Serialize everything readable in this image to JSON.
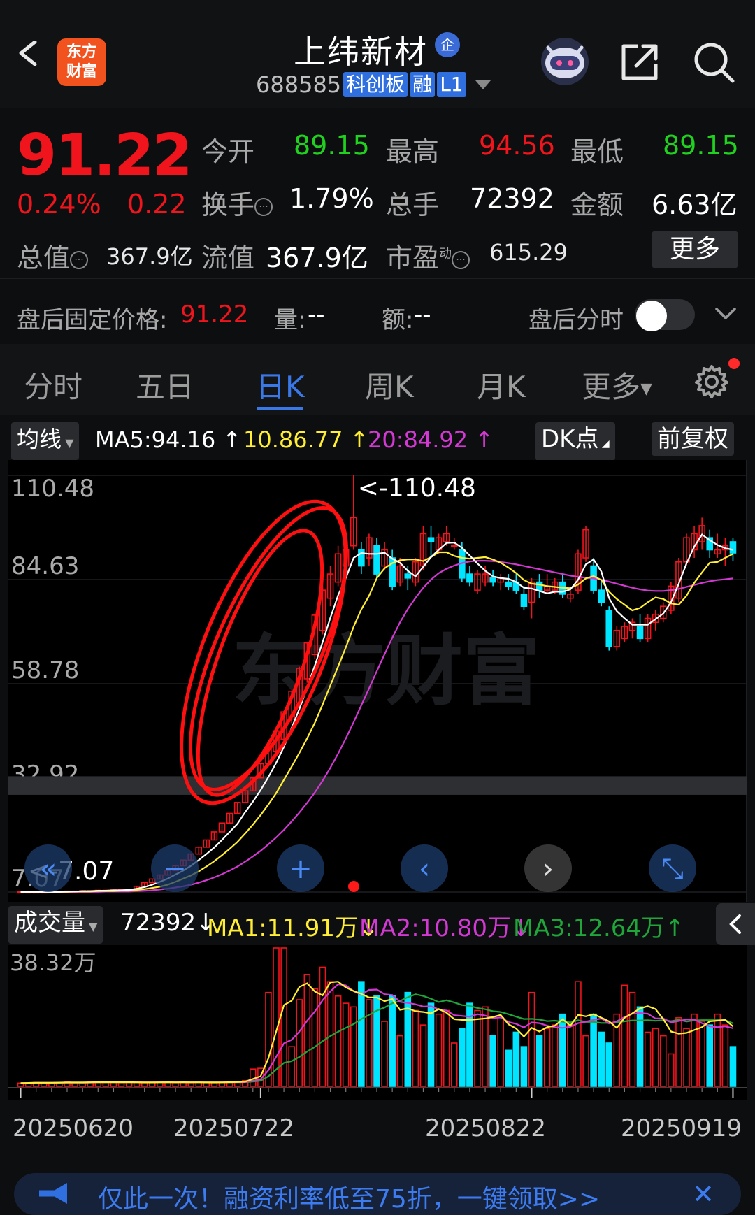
{
  "header": {
    "logo_text_1": "东方",
    "logo_text_2": "财富",
    "stock_name": "上纬新材",
    "badge": "企",
    "code": "688585",
    "tags": [
      "科创板",
      "融",
      "L1"
    ]
  },
  "quote": {
    "price": "91.22",
    "change_pct": "0.24%",
    "change": "0.22",
    "labels": {
      "open": "今开",
      "high": "最高",
      "low": "最低",
      "turnover": "换手",
      "volume": "总手",
      "amount": "金额",
      "total_value": "总值",
      "float_value": "流值",
      "pe": "市盈",
      "pe_sup": "动"
    },
    "values": {
      "open": "89.15",
      "high": "94.56",
      "low": "89.15",
      "turnover": "1.79%",
      "volume": "72392",
      "amount": "6.63亿",
      "total_value": "367.9亿",
      "float_value": "367.9亿",
      "pe": "615.29"
    },
    "more": "更多"
  },
  "after_hours": {
    "label": "盘后固定价格:",
    "price": "91.22",
    "vol_label": "量:",
    "vol_value": "--",
    "amt_label": "额:",
    "amt_value": "--",
    "intraday_label": "盘后分时"
  },
  "tabs": [
    "分时",
    "五日",
    "日K",
    "周K",
    "月K",
    "更多"
  ],
  "active_tab": "日K",
  "ma_bar": {
    "selector": "均线",
    "ma5": "MA5:94.16",
    "ma10": "10.86.77",
    "ma20": "20:84.92",
    "dk": "DK点",
    "fq": "前复权"
  },
  "colors": {
    "up": "#f0141c",
    "down": "#00e5ff",
    "ma5": "#ffffff",
    "ma10": "#ffee33",
    "ma20": "#d238d2",
    "ma3_vol": "#1fa53a",
    "accent": "#3b78e7"
  },
  "chart_data": {
    "type": "candlestick",
    "y_ticks": [
      "110.48",
      "84.63",
      "58.78",
      "32.92",
      "7.07"
    ],
    "ylim": [
      7.07,
      110.48
    ],
    "max_label": "<-110.48",
    "min_label": "<-7.07",
    "candles": [
      [
        7.1,
        7.2,
        7.0,
        7.1
      ],
      [
        7.1,
        7.1,
        7.0,
        7.1
      ],
      [
        7.1,
        7.2,
        7.0,
        7.1
      ],
      [
        7.1,
        7.2,
        7.0,
        7.1
      ],
      [
        7.1,
        7.2,
        7.0,
        7.2
      ],
      [
        7.2,
        7.3,
        7.1,
        7.2
      ],
      [
        7.2,
        7.3,
        7.1,
        7.3
      ],
      [
        7.3,
        7.4,
        7.2,
        7.3
      ],
      [
        7.3,
        7.4,
        7.2,
        7.4
      ],
      [
        7.4,
        7.5,
        7.3,
        7.4
      ],
      [
        7.4,
        7.5,
        7.3,
        7.5
      ],
      [
        7.5,
        7.6,
        7.4,
        7.5
      ],
      [
        7.5,
        7.6,
        7.4,
        7.6
      ],
      [
        7.6,
        7.7,
        7.5,
        7.7
      ],
      [
        7.7,
        7.8,
        7.6,
        7.8
      ],
      [
        7.8,
        8.5,
        7.8,
        8.5
      ],
      [
        8.5,
        9.5,
        8.5,
        9.4
      ],
      [
        9.4,
        10.4,
        9.4,
        10.3
      ],
      [
        10.3,
        11.4,
        10.3,
        11.3
      ],
      [
        11.3,
        12.5,
        11.3,
        12.4
      ],
      [
        12.4,
        13.7,
        12.4,
        13.6
      ],
      [
        13.6,
        15.0,
        13.6,
        15.0
      ],
      [
        15.0,
        16.5,
        15.0,
        16.5
      ],
      [
        16.5,
        18.2,
        16.5,
        18.2
      ],
      [
        18.2,
        20.0,
        18.2,
        20.0
      ],
      [
        20.0,
        22.0,
        20.0,
        22.0
      ],
      [
        22.0,
        24.2,
        22.0,
        24.2
      ],
      [
        24.2,
        26.6,
        24.2,
        26.6
      ],
      [
        26.6,
        29.3,
        26.6,
        29.3
      ],
      [
        29.3,
        32.2,
        29.3,
        32.2
      ],
      [
        32.2,
        35.4,
        32.2,
        35.4
      ],
      [
        35.4,
        38.9,
        35.4,
        38.9
      ],
      [
        38.9,
        42.8,
        38.9,
        42.8
      ],
      [
        42.0,
        47.1,
        41.0,
        47.1
      ],
      [
        45.0,
        52.0,
        44.0,
        51.8
      ],
      [
        50.0,
        57.0,
        49.0,
        56.9
      ],
      [
        54.0,
        63.0,
        53.0,
        62.6
      ],
      [
        60.0,
        69.0,
        59.0,
        68.9
      ],
      [
        66.0,
        76.0,
        65.0,
        75.8
      ],
      [
        72.0,
        83.0,
        71.0,
        82.0
      ],
      [
        80.0,
        88.0,
        78.0,
        86.0
      ],
      [
        84.0,
        93.0,
        83.0,
        91.0
      ],
      [
        88.0,
        94.0,
        85.0,
        92.0
      ],
      [
        93.0,
        110.48,
        92.0,
        100.0
      ],
      [
        92.0,
        94.0,
        86.0,
        88.0
      ],
      [
        90.0,
        96.0,
        88.0,
        95.0
      ],
      [
        93.0,
        95.0,
        85.0,
        86.0
      ],
      [
        88.0,
        94.0,
        87.0,
        92.0
      ],
      [
        90.0,
        92.0,
        82.0,
        83.0
      ],
      [
        84.0,
        90.0,
        83.0,
        88.0
      ],
      [
        86.0,
        88.0,
        82.0,
        85.0
      ],
      [
        84.0,
        90.0,
        83.0,
        89.0
      ],
      [
        88.0,
        98.0,
        87.0,
        96.0
      ],
      [
        95.0,
        98.0,
        90.0,
        94.0
      ],
      [
        92.0,
        96.0,
        91.0,
        95.0
      ],
      [
        94.0,
        98.0,
        93.0,
        96.0
      ],
      [
        93.0,
        95.0,
        92.0,
        93.0
      ],
      [
        92.0,
        94.0,
        84.0,
        85.0
      ],
      [
        86.0,
        88.0,
        83.0,
        84.0
      ],
      [
        82.0,
        87.0,
        81.0,
        86.0
      ],
      [
        84.0,
        88.0,
        83.0,
        86.0
      ],
      [
        85.0,
        87.0,
        83.0,
        84.0
      ],
      [
        84.0,
        86.0,
        82.0,
        85.0
      ],
      [
        84.0,
        86.0,
        82.0,
        83.0
      ],
      [
        84.0,
        86.0,
        81.0,
        82.0
      ],
      [
        81.0,
        83.0,
        77.0,
        78.0
      ],
      [
        79.0,
        85.0,
        75.0,
        84.0
      ],
      [
        84.0,
        86.0,
        80.0,
        82.0
      ],
      [
        82.0,
        86.0,
        81.0,
        83.0
      ],
      [
        82.0,
        85.0,
        81.0,
        84.0
      ],
      [
        84.0,
        86.0,
        80.0,
        81.0
      ],
      [
        80.0,
        82.0,
        79.0,
        81.0
      ],
      [
        82.0,
        92.0,
        81.0,
        91.0
      ],
      [
        90.0,
        98.0,
        89.0,
        97.0
      ],
      [
        88.0,
        90.0,
        81.0,
        82.0
      ],
      [
        82.0,
        84.0,
        78.0,
        79.0
      ],
      [
        77.0,
        78.0,
        67.0,
        68.0
      ],
      [
        68.0,
        73.0,
        67.0,
        72.0
      ],
      [
        70.0,
        74.0,
        69.0,
        73.0
      ],
      [
        72.0,
        75.0,
        70.0,
        74.0
      ],
      [
        73.0,
        76.0,
        69.0,
        70.0
      ],
      [
        70.0,
        76.0,
        69.0,
        75.0
      ],
      [
        74.0,
        77.0,
        72.0,
        76.0
      ],
      [
        75.0,
        79.0,
        74.0,
        78.0
      ],
      [
        77.0,
        84.0,
        76.0,
        83.0
      ],
      [
        80.0,
        90.0,
        79.0,
        89.0
      ],
      [
        89.0,
        96.0,
        88.0,
        95.0
      ],
      [
        92.0,
        98.0,
        90.0,
        96.0
      ],
      [
        94.0,
        100.0,
        92.0,
        98.0
      ],
      [
        95.0,
        97.0,
        90.0,
        92.0
      ],
      [
        91.0,
        96.0,
        90.0,
        92.0
      ],
      [
        92.0,
        95.0,
        88.0,
        93.0
      ],
      [
        94.0,
        95.0,
        89.15,
        91.22
      ]
    ],
    "ma5": [
      7.1,
      7.1,
      7.1,
      7.1,
      7.1,
      7.1,
      7.2,
      7.2,
      7.3,
      7.3,
      7.4,
      7.4,
      7.5,
      7.5,
      7.6,
      7.9,
      8.3,
      8.9,
      9.6,
      10.4,
      11.4,
      12.4,
      13.6,
      15.0,
      16.5,
      18.1,
      20.0,
      22.0,
      24.0,
      26.9,
      29.5,
      32.4,
      35.6,
      39.1,
      43.1,
      47.8,
      52.5,
      57.8,
      63.3,
      69.1,
      75.1,
      80.7,
      85.0,
      90.0,
      91.2,
      91.0,
      91.0,
      91.3,
      89.8,
      88.8,
      86.8,
      85.4,
      87.8,
      90.2,
      92.0,
      93.7,
      93.8,
      92.5,
      90.6,
      88.6,
      86.8,
      85.4,
      85.0,
      84.8,
      84.0,
      82.6,
      82.4,
      81.8,
      81.2,
      81.6,
      81.6,
      82.2,
      84.6,
      88.4,
      89.6,
      86.6,
      80.0,
      76.8,
      75.0,
      73.4,
      73.4,
      73.4,
      74.8,
      76.2,
      79.0,
      83.6,
      88.6,
      92.8,
      95.8,
      94.4,
      93.2,
      92.4,
      92.0
    ],
    "ma10": [
      7.1,
      7.1,
      7.1,
      7.1,
      7.1,
      7.1,
      7.1,
      7.2,
      7.2,
      7.2,
      7.3,
      7.3,
      7.3,
      7.4,
      7.4,
      7.6,
      7.8,
      8.1,
      8.4,
      8.9,
      9.6,
      10.4,
      11.2,
      12.2,
      13.4,
      14.7,
      16.2,
      17.8,
      19.5,
      21.6,
      23.8,
      26.2,
      28.8,
      31.6,
      34.9,
      38.2,
      41.6,
      45.2,
      49.1,
      53.6,
      58.3,
      63.0,
      67.8,
      72.9,
      77.2,
      80.6,
      85.0,
      87.4,
      88.7,
      89.4,
      89.6,
      89.6,
      89.2,
      90.2,
      91.4,
      91.4,
      90.5,
      90.0,
      89.8,
      90.0,
      90.2,
      89.6,
      88.8,
      87.6,
      86.2,
      84.5,
      83.6,
      83.4,
      83.0,
      82.8,
      82.6,
      82.5,
      83.4,
      84.9,
      85.5,
      84.5,
      81.6,
      79.8,
      78.4,
      77.0,
      77.6,
      79.0,
      80.2,
      79.8,
      78.7,
      78.4,
      80.6,
      83.8,
      86.4,
      88.8,
      89.0,
      90.0,
      91.0
    ],
    "ma20": [
      7.1,
      7.1,
      7.1,
      7.1,
      7.1,
      7.1,
      7.1,
      7.1,
      7.1,
      7.1,
      7.1,
      7.2,
      7.2,
      7.2,
      7.2,
      7.3,
      7.4,
      7.5,
      7.7,
      7.9,
      8.2,
      8.5,
      8.9,
      9.4,
      10.0,
      10.7,
      11.5,
      12.4,
      13.4,
      14.6,
      15.9,
      17.3,
      18.9,
      20.6,
      22.5,
      24.6,
      26.8,
      29.2,
      31.8,
      34.7,
      37.9,
      41.4,
      45.2,
      49.2,
      53.4,
      57.6,
      61.9,
      66.1,
      70.2,
      74.0,
      77.3,
      80.1,
      82.6,
      84.6,
      86.2,
      87.3,
      88.1,
      88.7,
      89.1,
      89.3,
      89.3,
      89.2,
      89.0,
      88.7,
      88.4,
      88.0,
      87.6,
      87.2,
      86.8,
      86.4,
      86.0,
      85.6,
      85.3,
      85.1,
      84.9,
      84.6,
      84.1,
      83.6,
      83.1,
      82.6,
      82.2,
      81.9,
      81.8,
      81.8,
      82.0,
      82.3,
      82.8,
      83.3,
      83.8,
      84.2,
      84.5,
      84.7,
      84.92
    ]
  },
  "volume_bar": {
    "selector": "成交量",
    "value": "72392",
    "ma1": "MA1:11.91万",
    "ma2": "MA2:10.80万",
    "ma3": "MA3:12.64万",
    "max_label": "38.32万"
  },
  "volume_data": {
    "ylim": [
      0,
      38.32
    ],
    "values": [
      0.9,
      1.0,
      1.1,
      1.0,
      1.0,
      1.1,
      1.2,
      1.1,
      1.0,
      1.2,
      1.3,
      1.2,
      1.1,
      1.0,
      1.2,
      1.1,
      1.0,
      1.1,
      1.2,
      1.3,
      1.0,
      1.1,
      1.0,
      1.2,
      1.1,
      1.0,
      1.2,
      1.3,
      1.4,
      1.6,
      4.8,
      5.0,
      26.0,
      38.32,
      38.32,
      11.0,
      24.0,
      31.0,
      27.0,
      33.0,
      29.0,
      25.0,
      23.0,
      22.0,
      29.0,
      24.0,
      25.0,
      18.0,
      25.0,
      14.0,
      26.0,
      21.0,
      17.0,
      23.0,
      20.0,
      21.0,
      12.0,
      16.0,
      23.0,
      21.0,
      22.0,
      14.0,
      19.0,
      10.0,
      15.0,
      11.0,
      26.0,
      14.0,
      16.0,
      17.0,
      20.0,
      17.0,
      29.0,
      14.0,
      20.0,
      15.0,
      12.0,
      20.0,
      28.0,
      26.0,
      22.0,
      15.0,
      16.0,
      14.0,
      9.0,
      19.0,
      16.0,
      20.0,
      18.0,
      17.0,
      20.0,
      17.0,
      11.0
    ],
    "dates": [
      "20250620",
      "20250722",
      "20250822",
      "20250919"
    ]
  },
  "ad": {
    "text": "仅此一次！融资利率低至75折，一键领取>>"
  }
}
